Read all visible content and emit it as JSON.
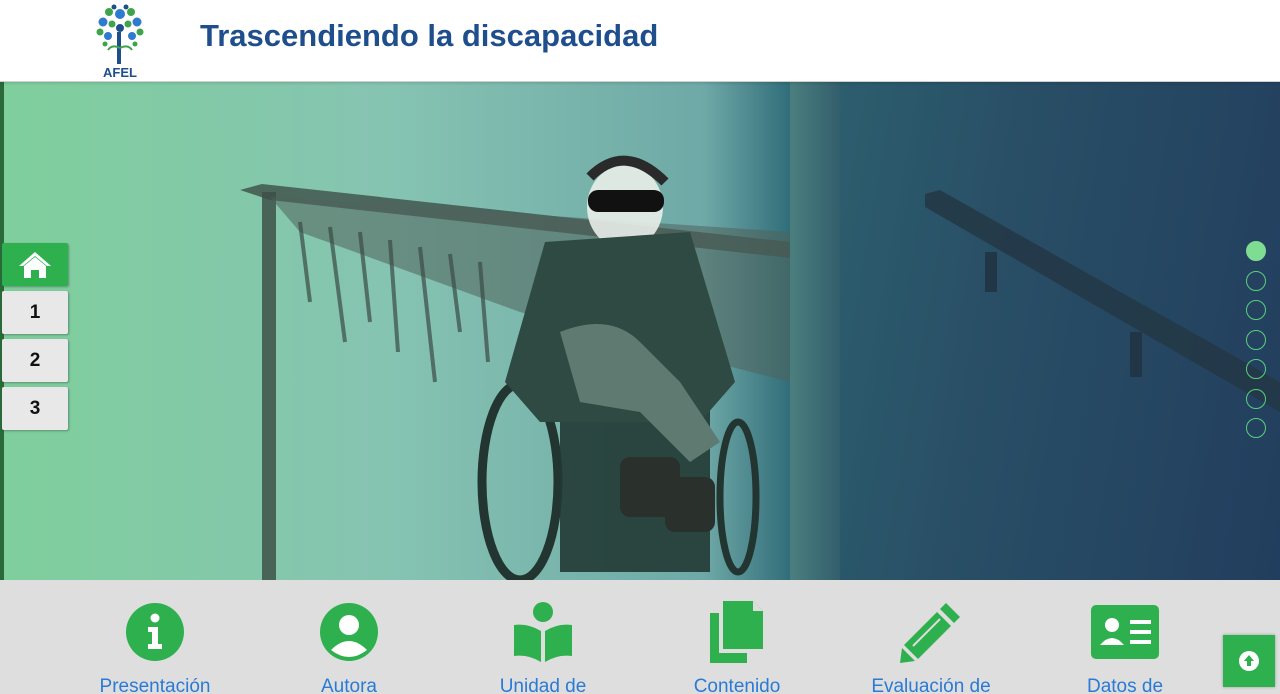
{
  "header": {
    "logo_text": "AFEL",
    "title": "Trascendiendo la discapacidad"
  },
  "side_nav": {
    "home_icon": "home-icon",
    "items": [
      "1",
      "2",
      "3"
    ]
  },
  "dot_nav": {
    "count": 7,
    "active_index": 0
  },
  "menu": {
    "items": [
      {
        "label": "Presentación",
        "icon": "info-circle-icon"
      },
      {
        "label": "Autora",
        "icon": "user-circle-icon"
      },
      {
        "label": "Unidad de",
        "icon": "book-reader-icon"
      },
      {
        "label": "Contenido",
        "icon": "copy-files-icon"
      },
      {
        "label": "Evaluación de",
        "icon": "pencil-icon"
      },
      {
        "label": "Datos de",
        "icon": "id-card-icon"
      }
    ]
  },
  "back_to_top": {
    "icon": "arrow-up-circle-icon"
  },
  "colors": {
    "brand_blue": "#1f4e8c",
    "accent_green": "#2fb04f",
    "link_blue": "#2a7ad6"
  }
}
